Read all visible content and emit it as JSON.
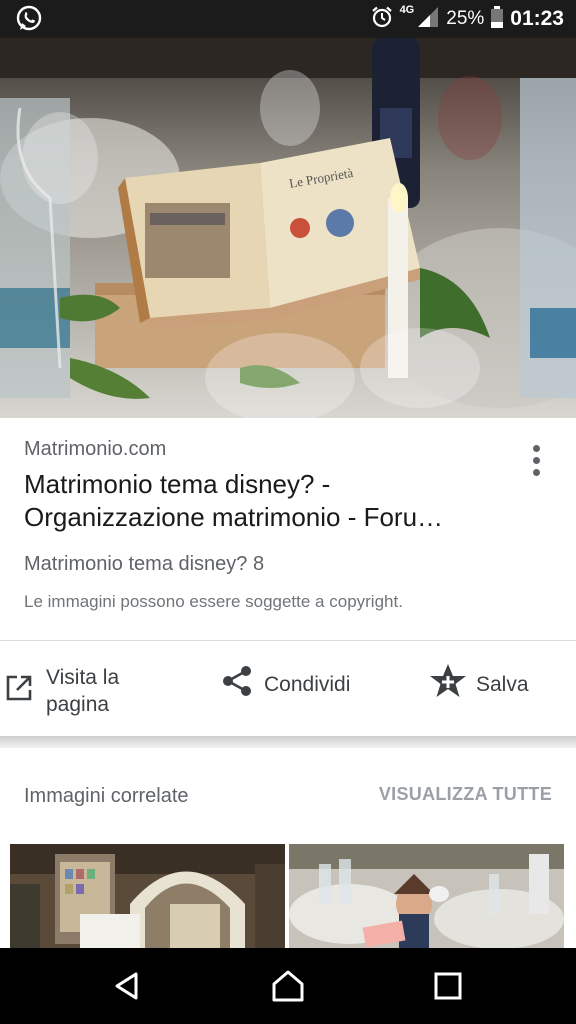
{
  "status_bar": {
    "network_type": "4G",
    "battery": "25%",
    "time": "01:23"
  },
  "result": {
    "source": "Matrimonio.com",
    "title_line1": "Matrimonio tema disney? -",
    "title_line2": "Organizzazione matrimonio - Foru…",
    "subtitle": "Matrimonio tema disney? 8",
    "copyright": "Le immagini possono essere soggette a copyright."
  },
  "actions": {
    "visit_line1": "Visita la",
    "visit_line2": "pagina",
    "share": "Condividi",
    "save": "Salva"
  },
  "related": {
    "label": "Immagini correlate",
    "see_all": "VISUALIZZA TUTTE"
  },
  "icons": {
    "status_left": "whatsapp-icon",
    "alarm": "alarm-icon",
    "signal": "signal-icon",
    "battery": "battery-icon",
    "more": "more-vert-icon",
    "visit": "open-in-new-icon",
    "share": "share-icon",
    "save": "star-add-icon",
    "nav_back": "back-icon",
    "nav_home": "home-icon",
    "nav_recent": "recent-apps-icon"
  },
  "colors": {
    "status_bar": "#1b1b1b",
    "text_primary": "#1a1a1a",
    "text_secondary": "#5f6368",
    "see_all": "#9aa0a6"
  }
}
